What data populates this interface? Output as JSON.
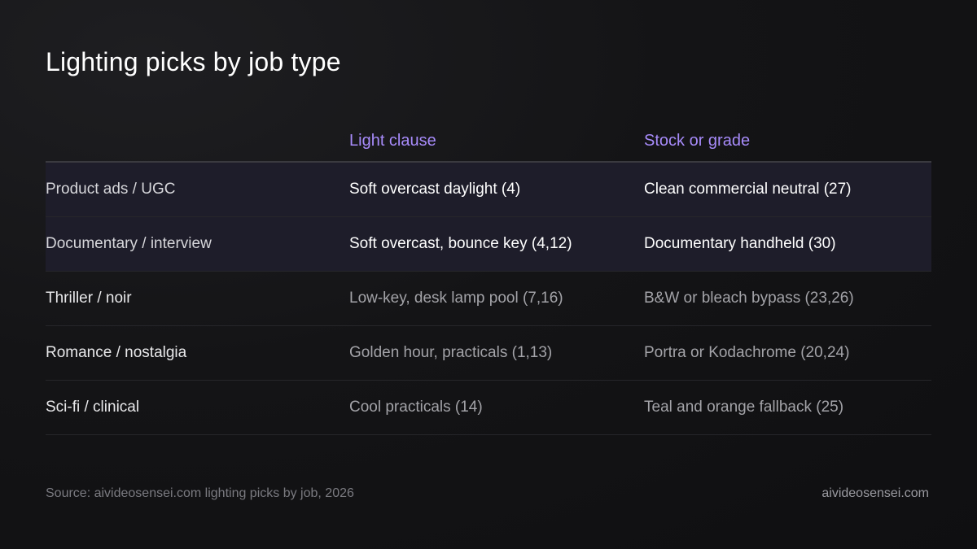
{
  "title": "Lighting picks by job type",
  "table": {
    "headers": [
      "",
      "Light clause",
      "Stock or grade"
    ],
    "rows": [
      {
        "job": "Product ads / UGC",
        "light": "Soft overcast daylight (4)",
        "stock": "Clean commercial neutral (27)",
        "highlight": true
      },
      {
        "job": "Documentary / interview",
        "light": "Soft overcast, bounce key (4,12)",
        "stock": "Documentary handheld (30)",
        "highlight": true
      },
      {
        "job": "Thriller / noir",
        "light": "Low-key, desk lamp pool (7,16)",
        "stock": "B&W or bleach bypass (23,26)",
        "highlight": false
      },
      {
        "job": "Romance / nostalgia",
        "light": "Golden hour, practicals (1,13)",
        "stock": "Portra or Kodachrome (20,24)",
        "highlight": false
      },
      {
        "job": "Sci-fi / clinical",
        "light": "Cool practicals (14)",
        "stock": "Teal and orange fallback (25)",
        "highlight": false
      }
    ]
  },
  "footer": {
    "source": "Source: aivideosensei.com lighting picks by job, 2026",
    "site": "aivideosensei.com"
  },
  "colors": {
    "accent": "#a78bfa",
    "highlight_row": "#1e1d2a",
    "background": "#141416"
  }
}
